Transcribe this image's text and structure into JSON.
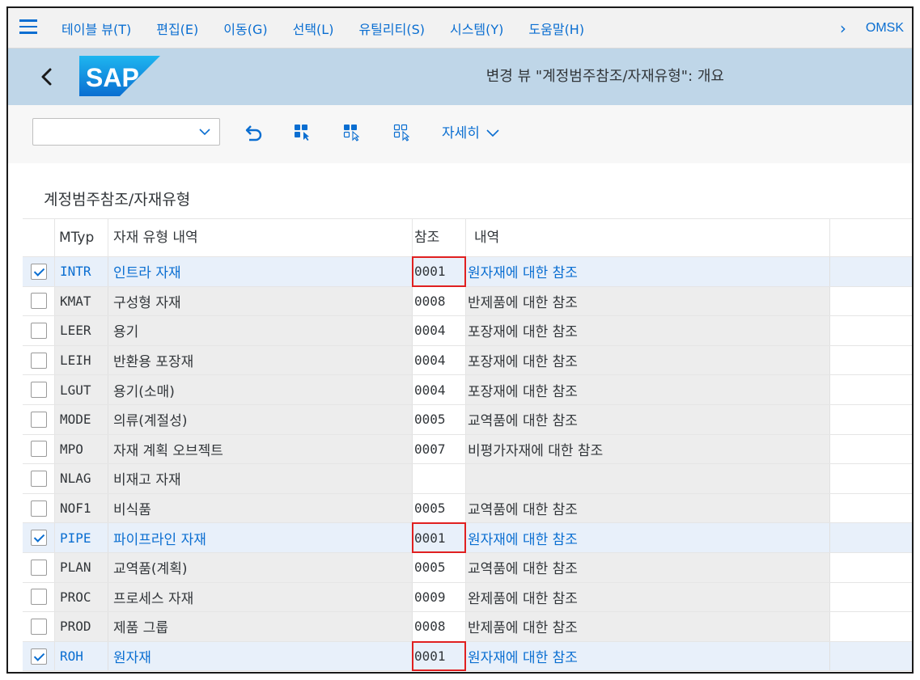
{
  "menu": {
    "items": [
      "테이블 뷰(T)",
      "편집(E)",
      "이동(G)",
      "선택(L)",
      "유틸리티(S)",
      "시스템(Y)",
      "도움말(H)"
    ],
    "system_id": "OMSK"
  },
  "title_bar": {
    "logo_text": "SAP",
    "title": "변경 뷰 \"계정범주참조/자재유형\": 개요"
  },
  "toolbar": {
    "variant_value": "",
    "more_label": "자세히"
  },
  "section": {
    "title": "계정범주참조/자재유형"
  },
  "table": {
    "columns": [
      "MTyp",
      "자재 유형 내역",
      "참조",
      "내역"
    ],
    "rows": [
      {
        "checked": true,
        "mtyp": "INTR",
        "desc": "인트라 자재",
        "ref": "0001",
        "ref_desc": "원자재에 대한 참조"
      },
      {
        "checked": false,
        "mtyp": "KMAT",
        "desc": "구성형 자재",
        "ref": "0008",
        "ref_desc": "반제품에 대한 참조"
      },
      {
        "checked": false,
        "mtyp": "LEER",
        "desc": "용기",
        "ref": "0004",
        "ref_desc": "포장재에 대한 참조"
      },
      {
        "checked": false,
        "mtyp": "LEIH",
        "desc": "반환용 포장재",
        "ref": "0004",
        "ref_desc": "포장재에 대한 참조"
      },
      {
        "checked": false,
        "mtyp": "LGUT",
        "desc": "용기(소매)",
        "ref": "0004",
        "ref_desc": "포장재에 대한 참조"
      },
      {
        "checked": false,
        "mtyp": "MODE",
        "desc": "의류(계절성)",
        "ref": "0005",
        "ref_desc": "교역품에 대한 참조"
      },
      {
        "checked": false,
        "mtyp": "MPO",
        "desc": "자재 계획 오브젝트",
        "ref": "0007",
        "ref_desc": "비평가자재에 대한 참조"
      },
      {
        "checked": false,
        "mtyp": "NLAG",
        "desc": "비재고 자재",
        "ref": "",
        "ref_desc": ""
      },
      {
        "checked": false,
        "mtyp": "NOF1",
        "desc": "비식품",
        "ref": "0005",
        "ref_desc": "교역품에 대한 참조"
      },
      {
        "checked": true,
        "mtyp": "PIPE",
        "desc": "파이프라인 자재",
        "ref": "0001",
        "ref_desc": "원자재에 대한 참조"
      },
      {
        "checked": false,
        "mtyp": "PLAN",
        "desc": "교역품(계획)",
        "ref": "0005",
        "ref_desc": "교역품에 대한 참조"
      },
      {
        "checked": false,
        "mtyp": "PROC",
        "desc": "프로세스 자재",
        "ref": "0009",
        "ref_desc": "완제품에 대한 참조"
      },
      {
        "checked": false,
        "mtyp": "PROD",
        "desc": "제품 그룹",
        "ref": "0008",
        "ref_desc": "반제품에 대한 참조"
      },
      {
        "checked": true,
        "mtyp": "ROH",
        "desc": "원자재",
        "ref": "0001",
        "ref_desc": "원자재에 대한 참조"
      }
    ]
  },
  "colors": {
    "accent": "#0a6ed1",
    "title_bar_bg": "#bfd6e8",
    "highlight_box": "#e02020"
  }
}
